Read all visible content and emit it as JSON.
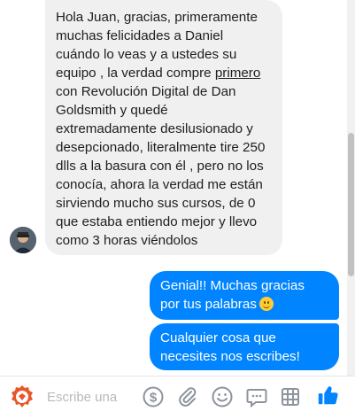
{
  "incoming": {
    "text_before": "Hola Juan, gracias, primeramente muchas felicidades a Daniel cuándo lo veas y a ustedes su equipo , la verdad compre ",
    "underlined": "primero",
    "text_after": " con Revolución Digital de Dan Goldsmith y quedé extremadamente desilusionado y desepcionado, literalmente tire 250 dlls a la basura con él , pero no los conocía, ahora la verdad me están sirviendo mucho sus cursos, de 0 que estaba entiendo mejor y llevo como 3 horas viéndolos"
  },
  "outgoing": [
    {
      "text": "Genial!! Muchas gracias por tus palabras"
    },
    {
      "text": "Cualquier cosa que necesites nos escribes!"
    }
  ],
  "composer": {
    "placeholder": "Escribe una",
    "icons": [
      "app-logo-icon",
      "dollar-icon",
      "paperclip-icon",
      "smile-icon",
      "speech-bubble-icon",
      "table-icon",
      "thumbs-up-icon"
    ]
  },
  "colors": {
    "accent": "#0084ff",
    "incoming_bg": "#f1f0f0",
    "icon": "#8d949e"
  }
}
